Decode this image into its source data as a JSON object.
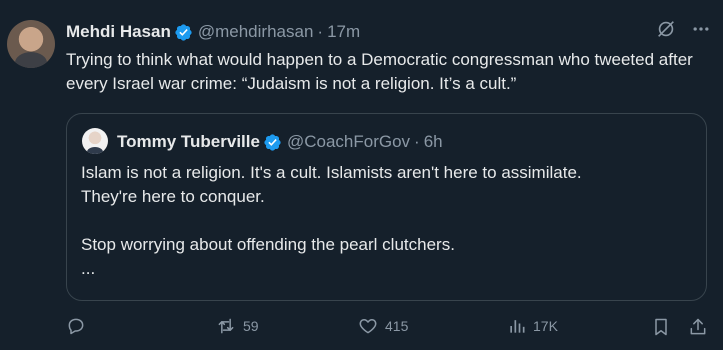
{
  "tweet": {
    "author_name": "Mehdi Hasan",
    "handle": "@mehdirhasan",
    "separator": "·",
    "time": "17m",
    "text": "Trying to think what would happen to a Democratic congressman who tweeted after every Israel war crime: “Judaism is not a religion. It’s a cult.”"
  },
  "quote": {
    "author_name": "Tommy Tuberville",
    "handle": "@CoachForGov",
    "separator": "·",
    "time": "6h",
    "line1": "Islam is not a religion. It's a cult. Islamists aren't here to assimilate.",
    "line2": "They're here to conquer.",
    "line3": "Stop worrying about offending the pearl clutchers.",
    "line4": "..."
  },
  "actions": {
    "reply_count": "",
    "retweet_count": "59",
    "like_count": "415",
    "view_count": "17K"
  },
  "colors": {
    "background": "#15202b",
    "text": "#e7e9ea",
    "muted": "#8b98a5",
    "verified": "#1d9bf0",
    "border": "#38444d"
  },
  "icons": [
    "verified-badge-icon",
    "grok-icon",
    "more-icon",
    "reply-icon",
    "retweet-icon",
    "like-icon",
    "views-icon",
    "bookmark-icon",
    "share-icon"
  ]
}
